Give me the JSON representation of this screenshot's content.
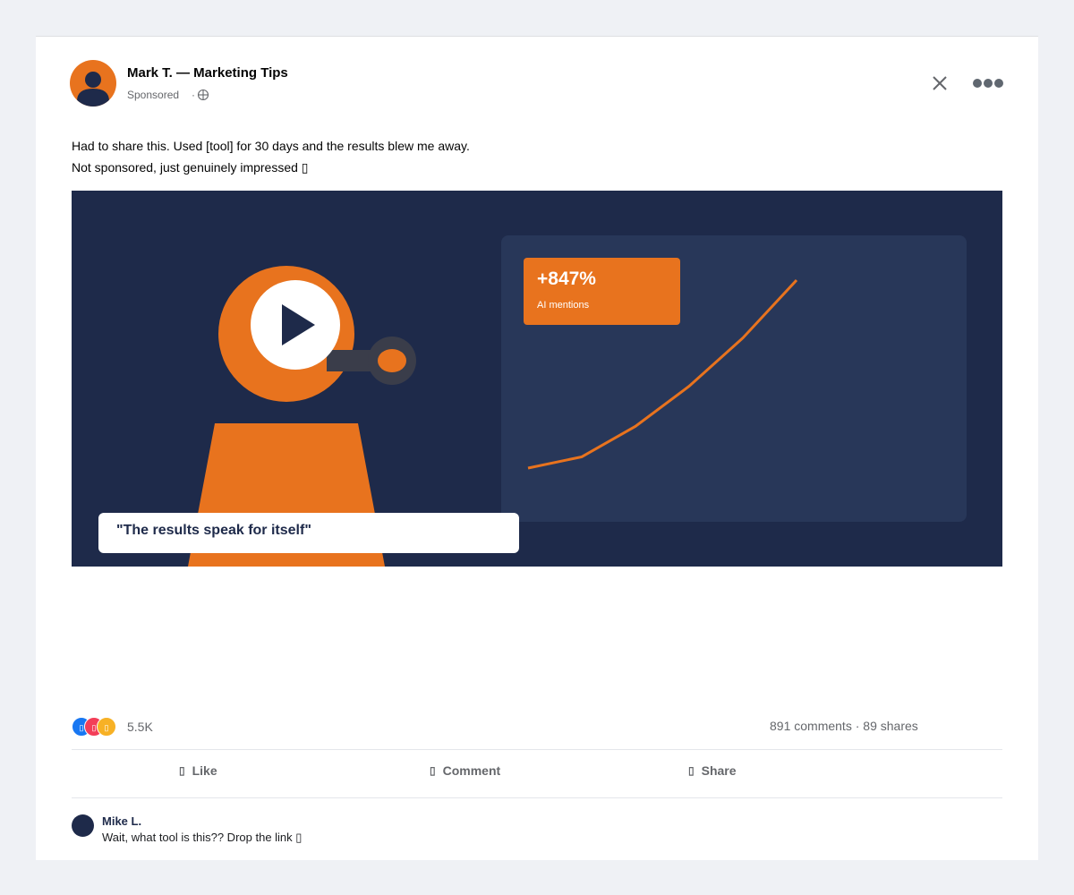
{
  "post": {
    "author": "Mark T. — Marketing Tips",
    "sponsored_label": "Sponsored",
    "separator": "·",
    "text_line1": "Had to share this. Used [tool] for 30 days and the results blew me away.",
    "text_line2": "Not sponsored, just genuinely impressed ▯"
  },
  "media": {
    "stat_value": "+847%",
    "stat_label": "AI mentions",
    "quote": "\"The results speak for itself\"",
    "chart_data": {
      "type": "line",
      "x": [
        1,
        2,
        3,
        4,
        5,
        6
      ],
      "y": [
        0,
        7,
        26,
        51,
        81,
        117
      ]
    }
  },
  "reactions": {
    "icons": [
      "like-icon",
      "love-icon",
      "haha-icon"
    ],
    "icon_glyphs": [
      "▯",
      "▯",
      "▯"
    ],
    "count": "5.5K"
  },
  "engagement": {
    "comments": "891 comments",
    "separator": "·",
    "shares": "89 shares"
  },
  "actions": {
    "like_icon": "▯",
    "like_label": "Like",
    "comment_icon": "▯",
    "comment_label": "Comment",
    "share_icon": "▯",
    "share_label": "Share"
  },
  "comment": {
    "author": "Mike L.",
    "text": "Wait, what tool is this?? Drop the link ▯"
  },
  "colors": {
    "accent": "#e8731e",
    "navy": "#1e2a4a",
    "panel": "#283759",
    "like": "#1877f2",
    "love": "#f33e58",
    "haha": "#f7b125"
  }
}
